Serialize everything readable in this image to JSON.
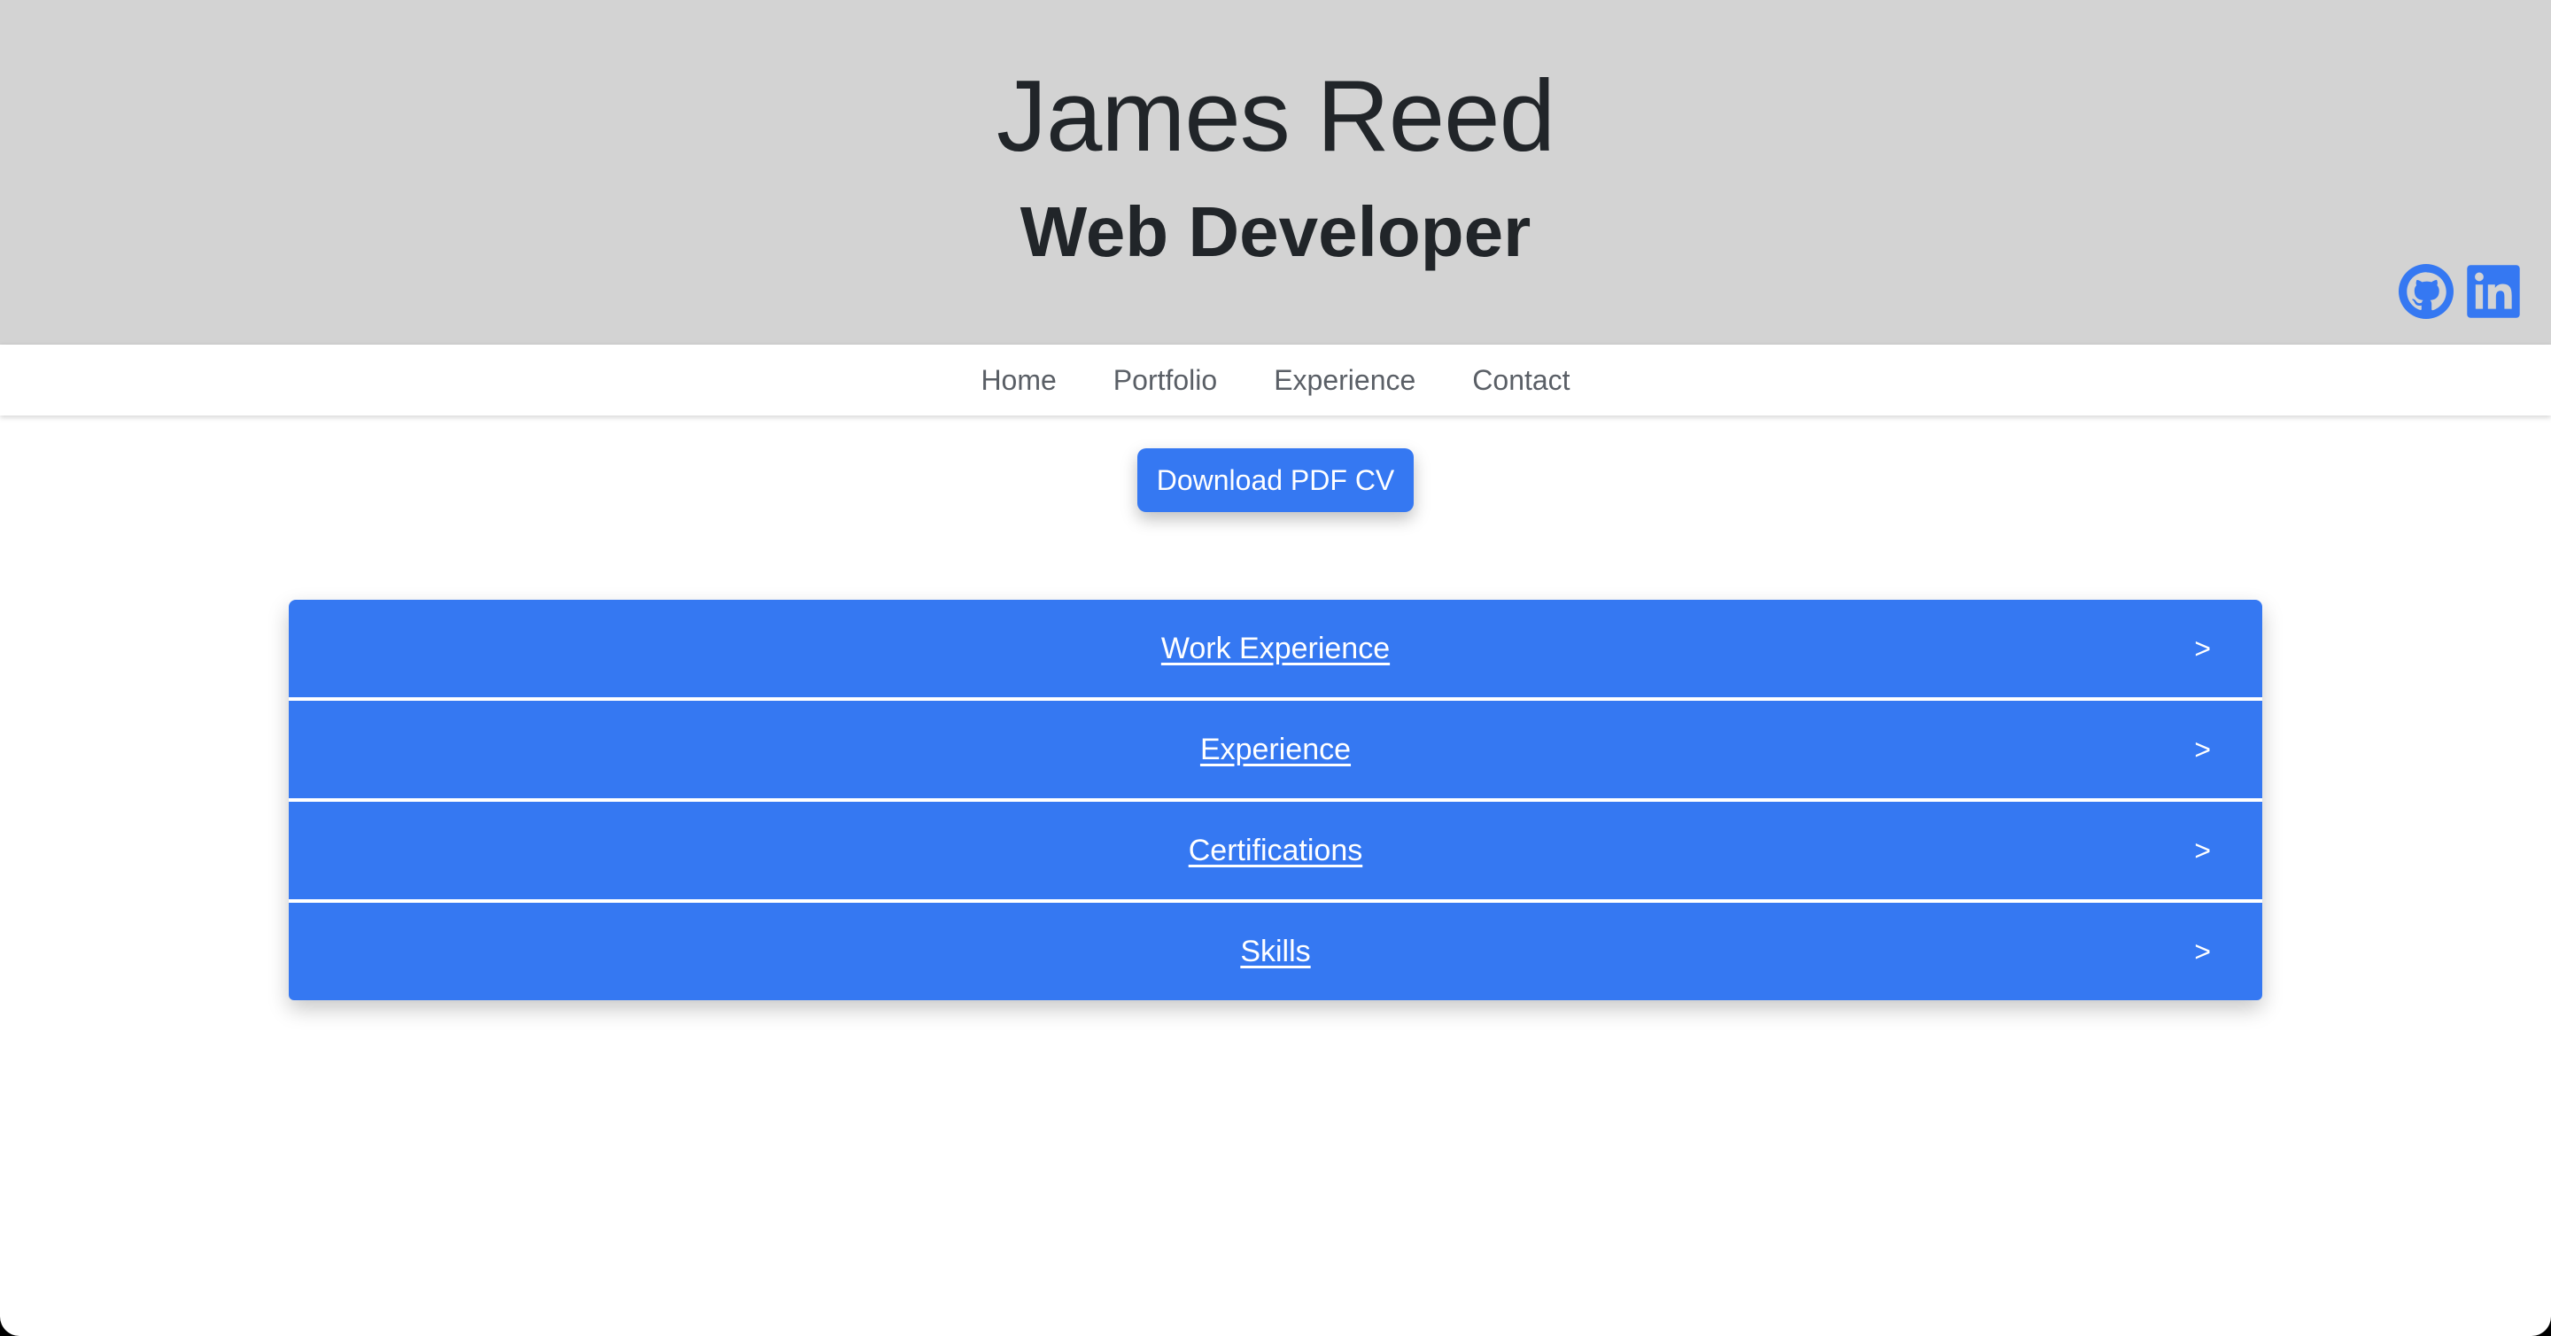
{
  "header": {
    "name": "James Reed",
    "role": "Web Developer",
    "social": [
      {
        "icon": "github-icon",
        "label": "GitHub"
      },
      {
        "icon": "linkedin-icon",
        "label": "LinkedIn"
      }
    ]
  },
  "nav": {
    "items": [
      "Home",
      "Portfolio",
      "Experience",
      "Contact"
    ]
  },
  "download": {
    "label": "Download PDF CV"
  },
  "accordion": {
    "items": [
      {
        "label": "Work Experience",
        "arrow": ">"
      },
      {
        "label": "Experience",
        "arrow": ">"
      },
      {
        "label": "Certifications",
        "arrow": ">"
      },
      {
        "label": "Skills",
        "arrow": ">"
      }
    ]
  },
  "colors": {
    "header_bg": "#d3d3d3",
    "accent": "#3578f2",
    "text_dark": "#212529",
    "nav_text": "#5a5f66"
  }
}
